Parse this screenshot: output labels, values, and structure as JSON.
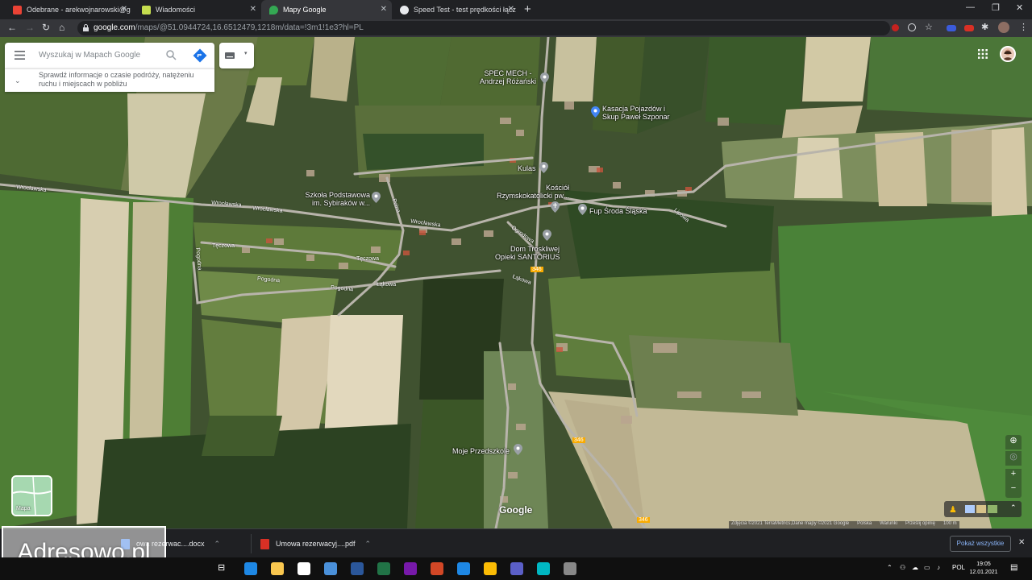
{
  "tabs": [
    {
      "title": "Odebrane - arekwojnarowski@g",
      "active": false,
      "favicon_color": "#ea4335"
    },
    {
      "title": "Wiadomości",
      "active": false,
      "favicon_color": "#c5dd4f"
    },
    {
      "title": "Mapy Google",
      "active": true,
      "favicon_color": "#34a853"
    },
    {
      "title": "Speed Test - test prędkości łącz",
      "active": false,
      "favicon_color": "#e8eaed"
    }
  ],
  "address": {
    "host": "google.com",
    "path": "/maps/@51.0944724,16.6512479,1218m/data=!3m1!1e3?hl=PL"
  },
  "search": {
    "placeholder": "Wyszukaj w Mapach Google"
  },
  "hint": {
    "text": "Sprawdź informacje o czasie podróży, natężeniu ruchu i miejscach w pobliżu"
  },
  "places": [
    {
      "line1": "SPEC MECH -",
      "line2": "Andrzej Różański"
    },
    {
      "line1": "Kasacja Pojazdów i",
      "line2": "Skup Paweł Szponar"
    },
    {
      "line1": "Kulas",
      "line2": ""
    },
    {
      "line1": "Kościół",
      "line2": "Rzymskokatolicki pw..."
    },
    {
      "line1": "Szkoła Podstawowa",
      "line2": "im. Sybiraków w..."
    },
    {
      "line1": "Fup Środa Śląska",
      "line2": ""
    },
    {
      "line1": "Dom Troskliwej",
      "line2": "Opieki SANTORIUS"
    },
    {
      "line1": "Moje Przedszkole",
      "line2": ""
    }
  ],
  "roads": [
    "Wrocławska",
    "Wrocławska",
    "Wrocławska",
    "Wrocławska",
    "Tęczowa",
    "Tęczowa",
    "Pogodna",
    "Pogodna",
    "Pogodna",
    "Łąkowa",
    "Łąkowa",
    "Ogrodowa",
    "Polna",
    "Lipowa",
    "346",
    "346",
    "346"
  ],
  "layer_toggle": {
    "label": "Mapa"
  },
  "brand": {
    "watermark": "Google"
  },
  "attribution": {
    "imagery": "Zdjęcia ©2021 TerraMetrics,Dane mapy ©2021 Google",
    "country": "Polska",
    "terms": "Warunki",
    "feedback": "Prześlij opinię",
    "scale": "100 m"
  },
  "downloads": [
    {
      "name": "owa rezerwac....docx",
      "color": "#4285f4"
    },
    {
      "name": "Umowa rezerwacyj....pdf",
      "color": "#d93025"
    }
  ],
  "downloads_show_all": "Pokaż wszystkie",
  "overlay_watermark": "Adresowo.pl",
  "taskbar": {
    "lang": "POL",
    "time": "19:05",
    "date": "12.01.2021",
    "apps": [
      {
        "name": "edge",
        "color": "#1e88e5"
      },
      {
        "name": "explorer",
        "color": "#f9c74f"
      },
      {
        "name": "store",
        "color": "#ffffff"
      },
      {
        "name": "mail",
        "color": "#4a90d9"
      },
      {
        "name": "word",
        "color": "#2b579a"
      },
      {
        "name": "excel",
        "color": "#217346"
      },
      {
        "name": "onenote",
        "color": "#7719aa"
      },
      {
        "name": "powerpoint",
        "color": "#d24726"
      },
      {
        "name": "calculator",
        "color": "#1e88e5"
      },
      {
        "name": "chrome",
        "color": "#fbbc05"
      },
      {
        "name": "teams",
        "color": "#5b5fc7"
      },
      {
        "name": "feedback",
        "color": "#00b7c3"
      },
      {
        "name": "snip",
        "color": "#888888"
      }
    ]
  }
}
